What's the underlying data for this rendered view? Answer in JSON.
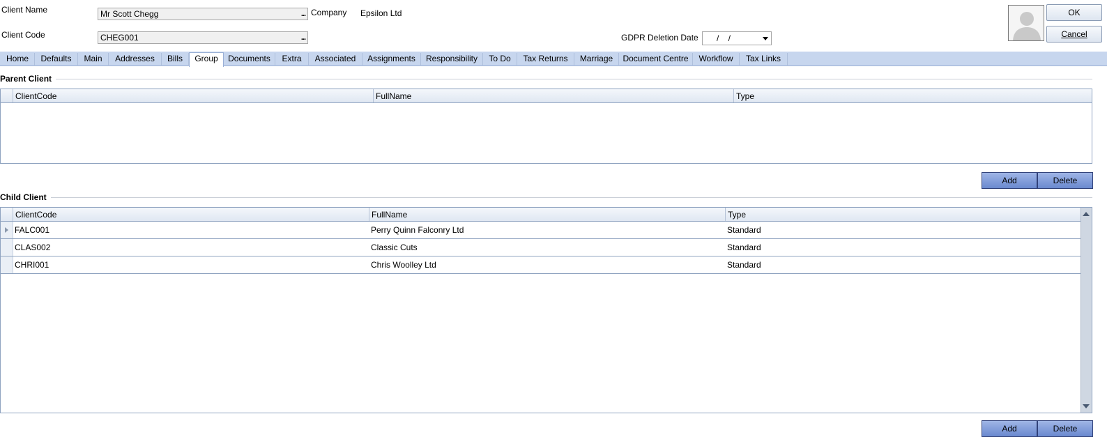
{
  "header": {
    "client_name_label": "Client Name",
    "client_name_value": "Mr Scott Chegg",
    "client_code_label": "Client Code",
    "client_code_value": "CHEG001",
    "ellipsis": "...",
    "company_label": "Company",
    "company_value": "Epsilon Ltd",
    "gdpr_label": "GDPR Deletion Date",
    "gdpr_value": "/    /",
    "ok_label": "OK",
    "cancel_label": "Cancel"
  },
  "tabs": [
    {
      "label": "Home"
    },
    {
      "label": "Defaults"
    },
    {
      "label": "Main"
    },
    {
      "label": "Addresses"
    },
    {
      "label": "Bills"
    },
    {
      "label": "Group"
    },
    {
      "label": "Documents"
    },
    {
      "label": "Extra"
    },
    {
      "label": "Associated"
    },
    {
      "label": "Assignments"
    },
    {
      "label": "Responsibility"
    },
    {
      "label": "To Do"
    },
    {
      "label": "Tax Returns"
    },
    {
      "label": "Marriage"
    },
    {
      "label": "Document Centre"
    },
    {
      "label": "Workflow"
    },
    {
      "label": "Tax Links"
    }
  ],
  "active_tab": "Group",
  "parent": {
    "title": "Parent Client",
    "columns": [
      "ClientCode",
      "FullName",
      "Type"
    ],
    "add_label": "Add",
    "delete_label": "Delete"
  },
  "child": {
    "title": "Child Client",
    "columns": [
      "ClientCode",
      "FullName",
      "Type"
    ],
    "rows": [
      {
        "code": "FALC001",
        "name": "Perry Quinn Falconry Ltd",
        "type": "Standard"
      },
      {
        "code": "CLAS002",
        "name": "Classic Cuts",
        "type": "Standard"
      },
      {
        "code": "CHRI001",
        "name": "Chris Woolley Ltd",
        "type": "Standard"
      }
    ],
    "add_label": "Add",
    "delete_label": "Delete"
  },
  "colors": {
    "tabbar": "#c7d6ee",
    "blue_button": "#7b96d6"
  }
}
